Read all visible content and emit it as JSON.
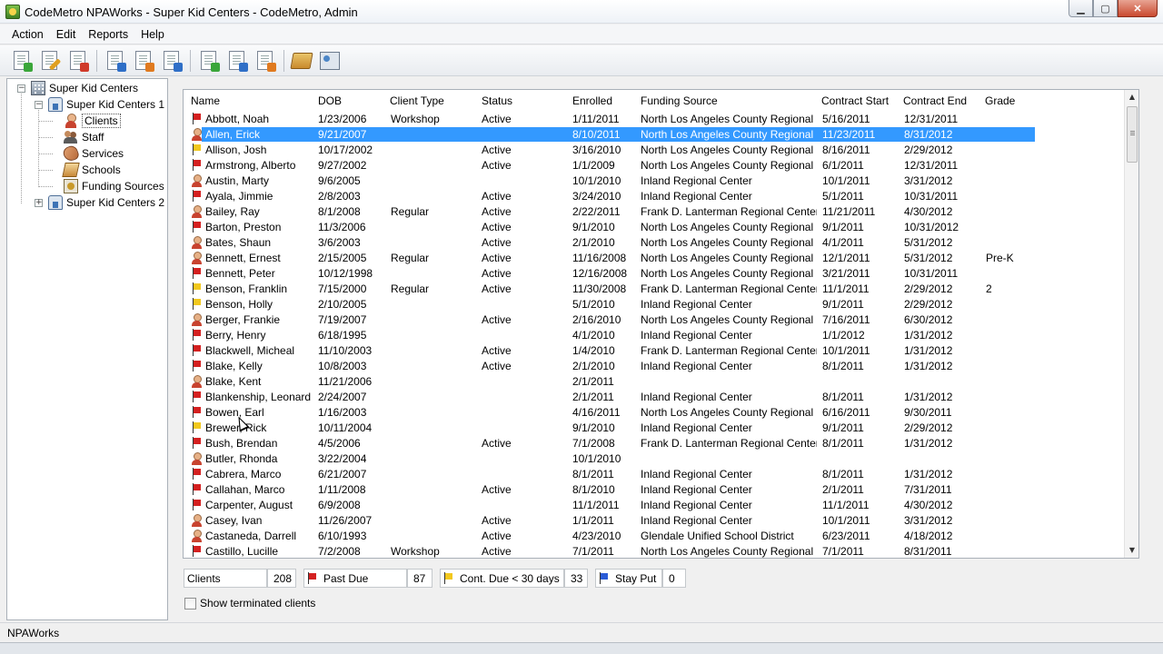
{
  "window": {
    "title": "CodeMetro NPAWorks - Super Kid Centers - CodeMetro, Admin"
  },
  "menu": [
    "Action",
    "Edit",
    "Reports",
    "Help"
  ],
  "toolbar": {
    "buttons": [
      "new-document-icon",
      "edit-document-icon",
      "delete-document-icon",
      "verify-icon",
      "report-icon",
      "chart-report-icon",
      "graph-icon",
      "checklist-icon",
      "lock-document-icon",
      "book-icon",
      "address-card-icon"
    ]
  },
  "tree": {
    "root": "Super Kid Centers",
    "center1": "Super Kid Centers 1",
    "children": [
      "Clients",
      "Staff",
      "Services",
      "Schools",
      "Funding Sources"
    ],
    "center2": "Super Kid Centers 2"
  },
  "grid": {
    "columns": [
      "Name",
      "DOB",
      "Client Type",
      "Status",
      "Enrolled",
      "Funding Source",
      "Contract Start",
      "Contract End",
      "Grade"
    ],
    "rows": [
      {
        "icon": "flag-red",
        "name": "Abbott, Noah",
        "dob": "1/23/2006",
        "type": "Workshop",
        "status": "Active",
        "enrolled": "1/11/2011",
        "funding": "North Los Angeles County Regional C...",
        "start": "5/16/2011",
        "end": "12/31/2011",
        "grade": ""
      },
      {
        "icon": "person",
        "name": "Allen, Erick",
        "dob": "9/21/2007",
        "type": "",
        "status": "",
        "enrolled": "8/10/2011",
        "funding": "North Los Angeles County Regional C...",
        "start": "11/23/2011",
        "end": "8/31/2012",
        "grade": "",
        "selected": true
      },
      {
        "icon": "flag-yellow",
        "name": "Allison, Josh",
        "dob": "10/17/2002",
        "type": "",
        "status": "Active",
        "enrolled": "3/16/2010",
        "funding": "North Los Angeles County Regional C...",
        "start": "8/16/2011",
        "end": "2/29/2012",
        "grade": ""
      },
      {
        "icon": "flag-red",
        "name": "Armstrong, Alberto",
        "dob": "9/27/2002",
        "type": "",
        "status": "Active",
        "enrolled": "1/1/2009",
        "funding": "North Los Angeles County Regional C...",
        "start": "6/1/2011",
        "end": "12/31/2011",
        "grade": ""
      },
      {
        "icon": "person",
        "name": "Austin, Marty",
        "dob": "9/6/2005",
        "type": "",
        "status": "",
        "enrolled": "10/1/2010",
        "funding": "Inland Regional Center",
        "start": "10/1/2011",
        "end": "3/31/2012",
        "grade": ""
      },
      {
        "icon": "flag-red",
        "name": "Ayala, Jimmie",
        "dob": "2/8/2003",
        "type": "",
        "status": "Active",
        "enrolled": "3/24/2010",
        "funding": "Inland Regional Center",
        "start": "5/1/2011",
        "end": "10/31/2011",
        "grade": ""
      },
      {
        "icon": "person",
        "name": "Bailey, Ray",
        "dob": "8/1/2008",
        "type": "Regular",
        "status": "Active",
        "enrolled": "2/22/2011",
        "funding": "Frank D. Lanterman Regional Center",
        "start": "11/21/2011",
        "end": "4/30/2012",
        "grade": ""
      },
      {
        "icon": "flag-red",
        "name": "Barton, Preston",
        "dob": "11/3/2006",
        "type": "",
        "status": "Active",
        "enrolled": "9/1/2010",
        "funding": "North Los Angeles County Regional C...",
        "start": "9/1/2011",
        "end": "10/31/2012",
        "grade": ""
      },
      {
        "icon": "person",
        "name": "Bates, Shaun",
        "dob": "3/6/2003",
        "type": "",
        "status": "Active",
        "enrolled": "2/1/2010",
        "funding": "North Los Angeles County Regional C...",
        "start": "4/1/2011",
        "end": "5/31/2012",
        "grade": ""
      },
      {
        "icon": "person",
        "name": "Bennett, Ernest",
        "dob": "2/15/2005",
        "type": "Regular",
        "status": "Active",
        "enrolled": "11/16/2008",
        "funding": "North Los Angeles County Regional C...",
        "start": "12/1/2011",
        "end": "5/31/2012",
        "grade": "Pre-K"
      },
      {
        "icon": "flag-red",
        "name": "Bennett, Peter",
        "dob": "10/12/1998",
        "type": "",
        "status": "Active",
        "enrolled": "12/16/2008",
        "funding": "North Los Angeles County Regional C...",
        "start": "3/21/2011",
        "end": "10/31/2011",
        "grade": ""
      },
      {
        "icon": "flag-yellow",
        "name": "Benson, Franklin",
        "dob": "7/15/2000",
        "type": "Regular",
        "status": "Active",
        "enrolled": "11/30/2008",
        "funding": "Frank D. Lanterman Regional Center",
        "start": "11/1/2011",
        "end": "2/29/2012",
        "grade": "2"
      },
      {
        "icon": "flag-yellow",
        "name": "Benson, Holly",
        "dob": "2/10/2005",
        "type": "",
        "status": "",
        "enrolled": "5/1/2010",
        "funding": "Inland Regional Center",
        "start": "9/1/2011",
        "end": "2/29/2012",
        "grade": ""
      },
      {
        "icon": "person",
        "name": "Berger, Frankie",
        "dob": "7/19/2007",
        "type": "",
        "status": "Active",
        "enrolled": "2/16/2010",
        "funding": "North Los Angeles County Regional C...",
        "start": "7/16/2011",
        "end": "6/30/2012",
        "grade": ""
      },
      {
        "icon": "flag-red",
        "name": "Berry, Henry",
        "dob": "6/18/1995",
        "type": "",
        "status": "",
        "enrolled": "4/1/2010",
        "funding": "Inland Regional Center",
        "start": "1/1/2012",
        "end": "1/31/2012",
        "grade": ""
      },
      {
        "icon": "flag-red",
        "name": "Blackwell, Micheal",
        "dob": "11/10/2003",
        "type": "",
        "status": "Active",
        "enrolled": "1/4/2010",
        "funding": "Frank D. Lanterman Regional Center",
        "start": "10/1/2011",
        "end": "1/31/2012",
        "grade": ""
      },
      {
        "icon": "flag-red",
        "name": "Blake, Kelly",
        "dob": "10/8/2003",
        "type": "",
        "status": "Active",
        "enrolled": "2/1/2010",
        "funding": "Inland Regional Center",
        "start": "8/1/2011",
        "end": "1/31/2012",
        "grade": ""
      },
      {
        "icon": "person",
        "name": "Blake, Kent",
        "dob": "11/21/2006",
        "type": "",
        "status": "",
        "enrolled": "2/1/2011",
        "funding": "",
        "start": "",
        "end": "",
        "grade": ""
      },
      {
        "icon": "flag-red",
        "name": "Blankenship, Leonard",
        "dob": "2/24/2007",
        "type": "",
        "status": "",
        "enrolled": "2/1/2011",
        "funding": "Inland Regional Center",
        "start": "8/1/2011",
        "end": "1/31/2012",
        "grade": ""
      },
      {
        "icon": "flag-red",
        "name": "Bowen, Earl",
        "dob": "1/16/2003",
        "type": "",
        "status": "",
        "enrolled": "4/16/2011",
        "funding": "North Los Angeles County Regional C...",
        "start": "6/16/2011",
        "end": "9/30/2011",
        "grade": ""
      },
      {
        "icon": "flag-yellow",
        "name": "Brewer, Rick",
        "dob": "10/11/2004",
        "type": "",
        "status": "",
        "enrolled": "9/1/2010",
        "funding": "Inland Regional Center",
        "start": "9/1/2011",
        "end": "2/29/2012",
        "grade": ""
      },
      {
        "icon": "flag-red",
        "name": "Bush, Brendan",
        "dob": "4/5/2006",
        "type": "",
        "status": "Active",
        "enrolled": "7/1/2008",
        "funding": "Frank D. Lanterman Regional Center",
        "start": "8/1/2011",
        "end": "1/31/2012",
        "grade": ""
      },
      {
        "icon": "person",
        "name": "Butler, Rhonda",
        "dob": "3/22/2004",
        "type": "",
        "status": "",
        "enrolled": "10/1/2010",
        "funding": "",
        "start": "",
        "end": "",
        "grade": ""
      },
      {
        "icon": "flag-red",
        "name": "Cabrera, Marco",
        "dob": "6/21/2007",
        "type": "",
        "status": "",
        "enrolled": "8/1/2011",
        "funding": "Inland Regional Center",
        "start": "8/1/2011",
        "end": "1/31/2012",
        "grade": ""
      },
      {
        "icon": "flag-red",
        "name": "Callahan, Marco",
        "dob": "1/11/2008",
        "type": "",
        "status": "Active",
        "enrolled": "8/1/2010",
        "funding": "Inland Regional Center",
        "start": "2/1/2011",
        "end": "7/31/2011",
        "grade": ""
      },
      {
        "icon": "flag-red",
        "name": "Carpenter, August",
        "dob": "6/9/2008",
        "type": "",
        "status": "",
        "enrolled": "11/1/2011",
        "funding": "Inland Regional Center",
        "start": "11/1/2011",
        "end": "4/30/2012",
        "grade": ""
      },
      {
        "icon": "person",
        "name": "Casey, Ivan",
        "dob": "11/26/2007",
        "type": "",
        "status": "Active",
        "enrolled": "1/1/2011",
        "funding": "Inland Regional Center",
        "start": "10/1/2011",
        "end": "3/31/2012",
        "grade": ""
      },
      {
        "icon": "person",
        "name": "Castaneda, Darrell",
        "dob": "6/10/1993",
        "type": "",
        "status": "Active",
        "enrolled": "4/23/2010",
        "funding": "Glendale Unified School District",
        "start": "6/23/2011",
        "end": "4/18/2012",
        "grade": ""
      },
      {
        "icon": "flag-red",
        "name": "Castillo, Lucille",
        "dob": "7/2/2008",
        "type": "Workshop",
        "status": "Active",
        "enrolled": "7/1/2011",
        "funding": "North Los Angeles County Regional C...",
        "start": "7/1/2011",
        "end": "8/31/2011",
        "grade": ""
      }
    ]
  },
  "counts": {
    "clients_label": "Clients",
    "clients_value": "208",
    "past_due_label": "Past Due",
    "past_due_value": "87",
    "cont_due_label": "Cont. Due < 30 days",
    "cont_due_value": "33",
    "stay_put_label": "Stay Put",
    "stay_put_value": "0"
  },
  "options": {
    "show_terminated": "Show terminated clients",
    "show_terminated_checked": false
  },
  "status": {
    "text": "NPAWorks"
  },
  "colors": {
    "selection": "#3399ff",
    "flag_red": "#d42020",
    "flag_yellow": "#f2c81e",
    "flag_blue": "#2a5bd7"
  }
}
